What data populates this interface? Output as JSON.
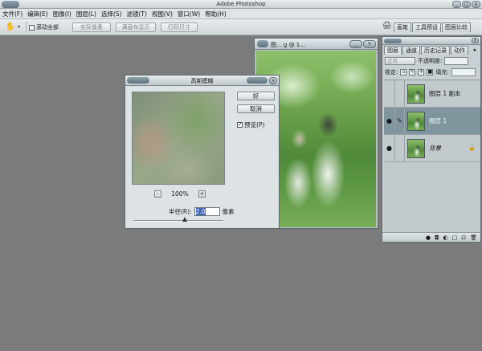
{
  "app": {
    "title": "Adobe Photoshop",
    "window_buttons": [
      "_",
      "□",
      "×"
    ]
  },
  "menu": [
    {
      "label": "文件(F)"
    },
    {
      "label": "编辑(E)"
    },
    {
      "label": "图像(I)"
    },
    {
      "label": "图层(L)"
    },
    {
      "label": "选择(S)"
    },
    {
      "label": "滤镜(T)"
    },
    {
      "label": "视图(V)"
    },
    {
      "label": "窗口(W)"
    },
    {
      "label": "帮助(H)"
    }
  ],
  "options": {
    "tool_icon": "hand-icon",
    "scroll_all_label": "滚动全部",
    "actual_pixels": "实际像素",
    "fit_screen": "满画布显示",
    "print_size": "打印尺寸"
  },
  "dock_tabs": [
    {
      "label": "画笔"
    },
    {
      "label": "工具预设"
    },
    {
      "label": "图层比较"
    }
  ],
  "document": {
    "title": "图... g @ 1...",
    "buttons": [
      "_",
      "□",
      "×"
    ]
  },
  "dialog": {
    "title": "高斯模糊",
    "ok": "好",
    "cancel": "取消",
    "preview_label": "预览(P)",
    "preview_checked": "✓",
    "zoom_minus": "-",
    "zoom_value": "100%",
    "zoom_plus": "+",
    "radius_label": "半径(R):",
    "radius_value": "2.0",
    "radius_unit": "像素",
    "close": "×"
  },
  "layers_panel": {
    "tabs": [
      {
        "label": "图层"
      },
      {
        "label": "通道"
      },
      {
        "label": "历史记录"
      },
      {
        "label": "动作"
      }
    ],
    "menu_btn": "▸",
    "blend_mode": "正常",
    "opacity_label": "不透明度:",
    "lock_label": "锁定:",
    "fill_label": "填充:",
    "close": "×",
    "layers": [
      {
        "name": "图层 1 副本",
        "eye": "",
        "brush": ""
      },
      {
        "name": "图层 1",
        "eye": "●",
        "brush": "✎"
      },
      {
        "name": "背景",
        "eye": "●",
        "brush": "",
        "lock": "🔒"
      }
    ],
    "footer_icons": [
      "●",
      "◘",
      "◐",
      "□",
      "⊡",
      "🗑"
    ]
  }
}
